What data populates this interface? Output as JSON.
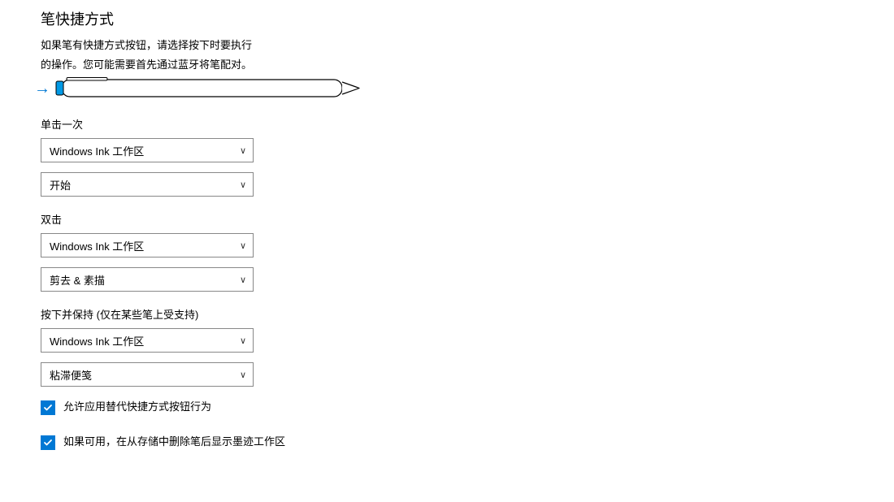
{
  "title": "笔快捷方式",
  "description_line1": "如果笔有快捷方式按钮，请选择按下时要执行",
  "description_line2": "的操作。您可能需要首先通过蓝牙将笔配对。",
  "sections": {
    "single_click": {
      "label": "单击一次",
      "dropdown1": "Windows Ink 工作区",
      "dropdown2": "开始"
    },
    "double_click": {
      "label": "双击",
      "dropdown1": "Windows Ink 工作区",
      "dropdown2": "剪去 & 素描"
    },
    "press_hold": {
      "label": "按下并保持 (仅在某些笔上受支持)",
      "dropdown1": "Windows Ink 工作区",
      "dropdown2": "粘滞便笺"
    }
  },
  "checkboxes": {
    "allow_apps": "允许应用替代快捷方式按钮行为",
    "show_ink": "如果可用，在从存储中删除笔后显示墨迹工作区"
  }
}
